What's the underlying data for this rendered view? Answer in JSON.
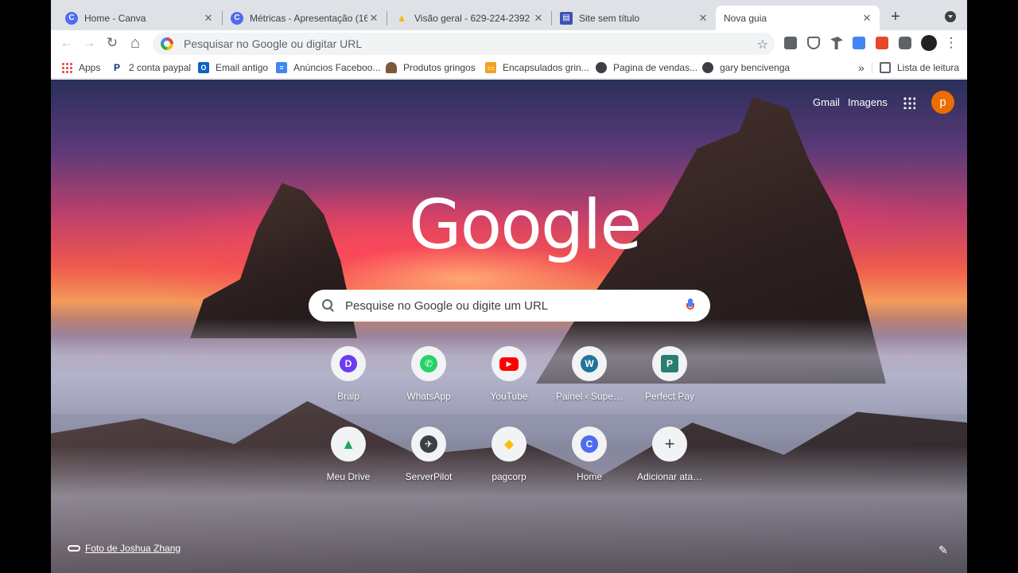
{
  "tabs": [
    {
      "title": "Home - Canva",
      "fav_color": "#4f6bf0",
      "fav_glyph": "C"
    },
    {
      "title": "Métricas - Apresentação (16",
      "fav_color": "#4f6bf0",
      "fav_glyph": "C"
    },
    {
      "title": "Visão geral - 629-224-2392",
      "fav_color": "#fbbc05",
      "fav_glyph": "▲"
    },
    {
      "title": "Site sem título",
      "fav_color": "#3f51b5",
      "fav_glyph": "▤"
    },
    {
      "title": "Nova guia",
      "active": true
    }
  ],
  "toolbar": {
    "omnibox_placeholder": "Pesquisar no Google ou digitar URL",
    "back": "←",
    "forward": "→",
    "reload": "↻",
    "home": "⌂",
    "star": "☆",
    "menu": "⋮"
  },
  "bookmarks": [
    {
      "label": "Apps",
      "icon": "apps-icon",
      "color": "#ea4335"
    },
    {
      "label": "2 conta paypal",
      "icon": "paypal-icon",
      "color": "#003087"
    },
    {
      "label": "Email antigo",
      "icon": "outlook-icon",
      "color": "#0a64c2"
    },
    {
      "label": "Anúncios Faceboo...",
      "icon": "docs-icon",
      "color": "#4285f4"
    },
    {
      "label": "Produtos gringos",
      "icon": "hat-icon",
      "color": "#7a5a3a"
    },
    {
      "label": "Encapsulados grin...",
      "icon": "slides-icon",
      "color": "#f4a025"
    },
    {
      "label": "Pagina de vendas...",
      "icon": "globe-icon",
      "color": "#3c4043"
    },
    {
      "label": "gary bencivenga",
      "icon": "globe-icon",
      "color": "#3c4043"
    }
  ],
  "bookmarks_more": "»",
  "reading_list": "Lista de leitura",
  "header": {
    "gmail": "Gmail",
    "images": "Imagens",
    "avatar": "p"
  },
  "logo": "Google",
  "search_placeholder": "Pesquise no Google ou digite um URL",
  "shortcuts": [
    {
      "label": "Braip",
      "color": "#6c3bf5",
      "glyph": "D"
    },
    {
      "label": "WhatsApp",
      "color": "#25d366",
      "glyph": "✆"
    },
    {
      "label": "YouTube",
      "color": "#ff0000",
      "glyph": "▶"
    },
    {
      "label": "Painel ‹ Supe…",
      "color": "#21759b",
      "glyph": "W"
    },
    {
      "label": "Perfect Pay",
      "color": "#2a7d73",
      "glyph": "P"
    },
    {
      "label": "Meu Drive",
      "color": "#1fa463",
      "glyph": "▲"
    },
    {
      "label": "ServerPilot",
      "color": "#3c4043",
      "glyph": "✈"
    },
    {
      "label": "pagcorp",
      "color": "#fbbc05",
      "glyph": "◆"
    },
    {
      "label": "Home",
      "color": "#4f6bf0",
      "glyph": "C"
    },
    {
      "label": "Adicionar ata…",
      "color": "#f1f3f4",
      "glyph": "+"
    }
  ],
  "credit": "Foto de Joshua Zhang",
  "customize": "✎"
}
